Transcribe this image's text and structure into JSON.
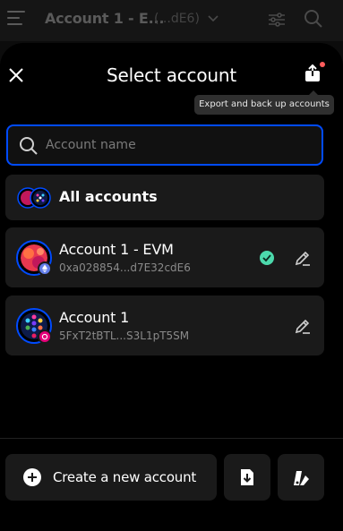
{
  "topbar": {
    "account_title": "Account 1 - E...",
    "account_addr": "(...dE6)"
  },
  "modal": {
    "title": "Select account",
    "tooltip": "Export and back up accounts"
  },
  "search": {
    "placeholder": "Account name",
    "value": ""
  },
  "accounts": [
    {
      "name": "All accounts"
    },
    {
      "name": "Account 1 - EVM",
      "address": "0xa028854...d7E32cdE6",
      "selected": true
    },
    {
      "name": "Account 1",
      "address": "5FxT2tBTL...S3L1pT5SM",
      "selected": false
    }
  ],
  "footer": {
    "create_label": "Create a new account"
  },
  "colors": {
    "accent": "#004bff",
    "check": "#4cd9ac",
    "card": "#1a1a1a",
    "background": "#000000"
  }
}
